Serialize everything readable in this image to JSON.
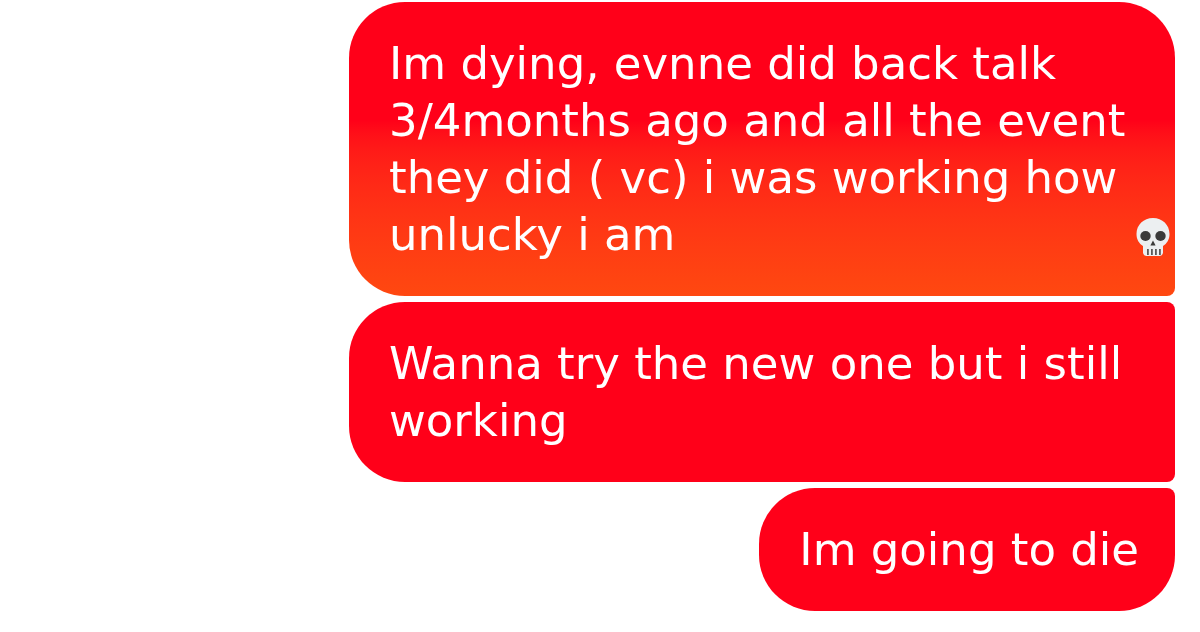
{
  "messages": [
    {
      "text": "Im dying, evnne did back talk 3/4months ago and all the event they did ( vc) i was working how unlucky i am",
      "skull_emoji": true
    },
    {
      "text": "Wanna try the new one but i still working",
      "skull_emoji": false
    },
    {
      "text": "Im going to die",
      "skull_emoji": false
    }
  ]
}
